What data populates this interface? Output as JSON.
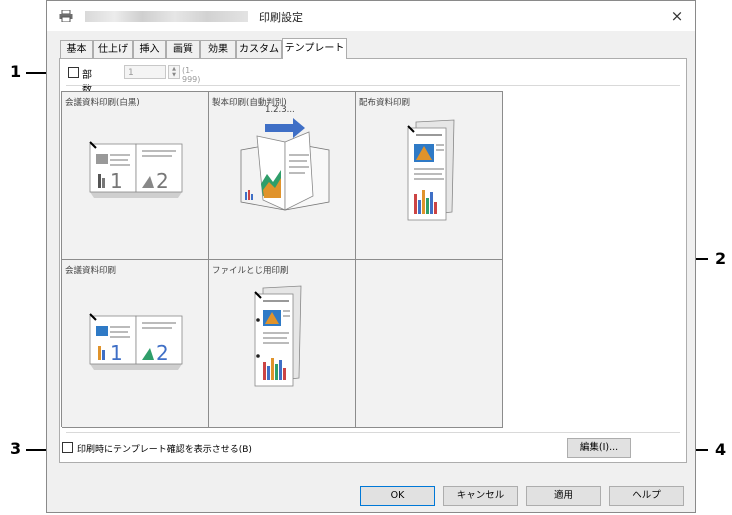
{
  "window": {
    "title": "印刷設定",
    "close_glyph": "×"
  },
  "tabs": [
    {
      "label": "基本",
      "active": false
    },
    {
      "label": "仕上げ",
      "active": false
    },
    {
      "label": "挿入",
      "active": false
    },
    {
      "label": "画質",
      "active": false
    },
    {
      "label": "効果",
      "active": false
    },
    {
      "label": "カスタム",
      "active": false
    },
    {
      "label": "テンプレート",
      "active": true
    }
  ],
  "copies": {
    "label": "部数(U):",
    "value": "1",
    "range": "(1-999)",
    "checked": false
  },
  "templates": [
    {
      "label": "会議資料印刷(白黒)",
      "icon": "meeting-doc-mono-icon"
    },
    {
      "label": "製本印刷(自動判別)",
      "icon": "booklet-icon",
      "badge": "1.2.3..."
    },
    {
      "label": "配布資料印刷",
      "icon": "handout-icon"
    },
    {
      "label": "会議資料印刷",
      "icon": "meeting-doc-icon"
    },
    {
      "label": "ファイルとじ用印刷",
      "icon": "file-binding-icon"
    },
    {
      "label": "",
      "icon": ""
    }
  ],
  "confirm": {
    "label": "印刷時にテンプレート確認を表示させる(B)",
    "checked": false
  },
  "buttons": {
    "edit": "編集(I)...",
    "ok": "OK",
    "cancel": "キャンセル",
    "apply": "適用",
    "help": "ヘルプ"
  },
  "callouts": {
    "c1": "1",
    "c2": "2",
    "c3": "3",
    "c4": "4"
  }
}
